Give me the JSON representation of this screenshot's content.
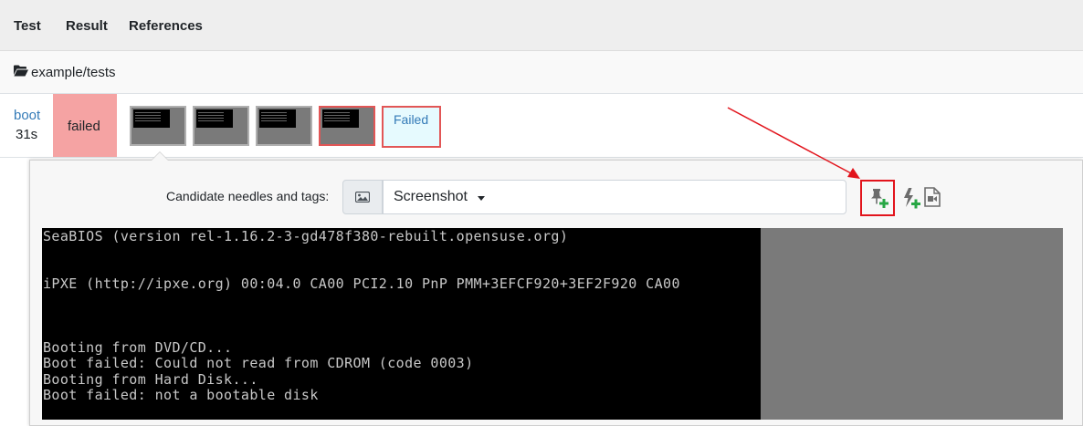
{
  "header": {
    "columns": [
      "Test",
      "Result",
      "References"
    ]
  },
  "directory": {
    "icon": "folder-open-icon",
    "path": "example/tests"
  },
  "test": {
    "name": "boot",
    "duration": "31s",
    "result": "failed",
    "result_color": "#f5a3a3",
    "failed_label": "Failed"
  },
  "panel": {
    "candidate_label": "Candidate needles and tags:",
    "select_value": "Screenshot",
    "icons": [
      "image-icon",
      "pin-add-icon",
      "bolt-add-icon",
      "video-file-icon"
    ]
  },
  "console": [
    "SeaBIOS (version rel-1.16.2-3-gd478f380-rebuilt.opensuse.org)",
    "iPXE (http://ipxe.org) 00:04.0 CA00 PCI2.10 PnP PMM+3EFCF920+3EF2F920 CA00",
    "Booting from DVD/CD...",
    "Boot failed: Could not read from CDROM (code 0003)",
    "Booting from Hard Disk...",
    "Boot failed: not a bootable disk"
  ],
  "colors": {
    "highlight": "#e2141c",
    "link": "#337ab7",
    "add_green": "#28a745"
  }
}
